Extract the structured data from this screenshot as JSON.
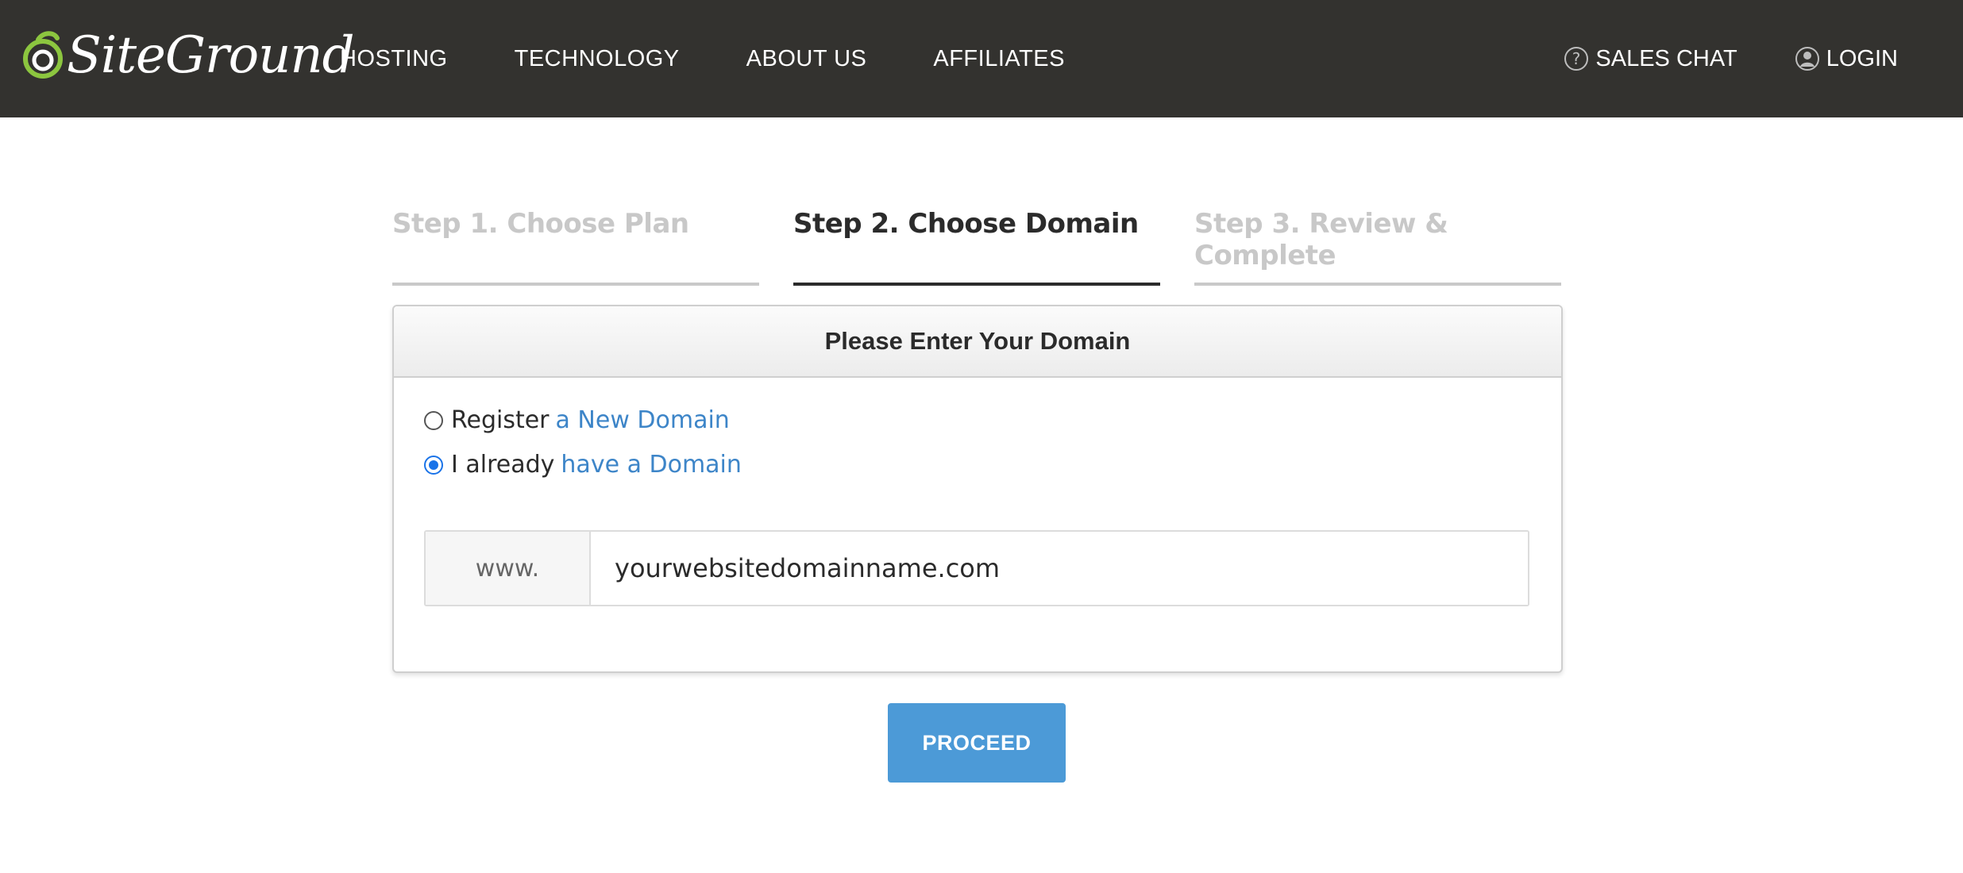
{
  "header": {
    "brand": "SiteGround",
    "nav": [
      {
        "label": "HOSTING"
      },
      {
        "label": "TECHNOLOGY"
      },
      {
        "label": "ABOUT US"
      },
      {
        "label": "AFFILIATES"
      }
    ],
    "sales_chat": {
      "label": "SALES CHAT",
      "icon": "question-circle-icon"
    },
    "login": {
      "label": "LOGIN",
      "icon": "user-circle-icon"
    }
  },
  "steps": [
    {
      "label": "Step 1. Choose Plan",
      "active": false
    },
    {
      "label": "Step 2. Choose Domain",
      "active": true
    },
    {
      "label": "Step 3. Review & Complete",
      "active": false
    }
  ],
  "panel": {
    "title": "Please Enter Your Domain",
    "options": [
      {
        "prefix": "Register",
        "link": "a New Domain",
        "checked": false
      },
      {
        "prefix": "I already",
        "link": "have a Domain",
        "checked": true
      }
    ],
    "domain_prefix": "www.",
    "domain_value": "yourwebsitedomainname.com"
  },
  "proceed_label": "PROCEED",
  "colors": {
    "topbar": "#33322f",
    "brand_green": "#8cc63f",
    "link": "#3d85c8",
    "button": "#4c9ad7"
  }
}
